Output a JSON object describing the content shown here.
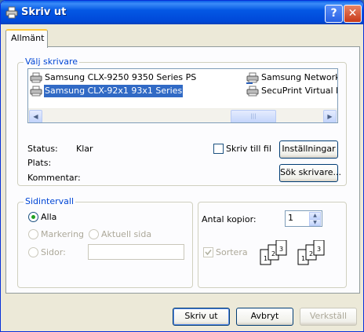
{
  "window": {
    "title": "Skriv ut",
    "help_label": "?",
    "close_label": "✕"
  },
  "tabs": [
    {
      "label": "Allmänt"
    }
  ],
  "printer_group": {
    "legend": "Välj skrivare",
    "printers": [
      {
        "name": "Samsung CLX-9250 9350 Series PS",
        "selected": false
      },
      {
        "name": "Samsung CLX-92x1 93x1 Series",
        "selected": true
      },
      {
        "name": "Samsung Network Pr",
        "selected": false
      },
      {
        "name": "SecuPrint Virtual Driv",
        "selected": false
      }
    ],
    "scroll_left": "◀",
    "scroll_right": "▶",
    "scroll_thumb": "|||"
  },
  "status": {
    "status_label": "Status:",
    "status_value": "Klar",
    "location_label": "Plats:",
    "location_value": "",
    "comment_label": "Kommentar:",
    "comment_value": ""
  },
  "print_to_file": {
    "label": "Skriv till fil",
    "checked": false
  },
  "buttons": {
    "preferences": "Inställningar",
    "find_printer": "Sök skrivare...",
    "print": "Skriv ut",
    "cancel": "Avbryt",
    "apply": "Verkställ"
  },
  "page_range": {
    "legend": "Sidintervall",
    "all": "Alla",
    "selection": "Markering",
    "current_page": "Aktuell sida",
    "pages": "Sidor:",
    "pages_value": "",
    "selected_option": "all"
  },
  "copies": {
    "label": "Antal kopior:",
    "value": "1",
    "collate_label": "Sortera",
    "collate_checked": true,
    "collate_icon_pages": [
      "1",
      "2",
      "3"
    ]
  },
  "colors": {
    "titlebar": "#0054e3",
    "selection": "#316ac5",
    "group_legend": "#0046d5",
    "dialog_bg": "#ece9d8"
  }
}
